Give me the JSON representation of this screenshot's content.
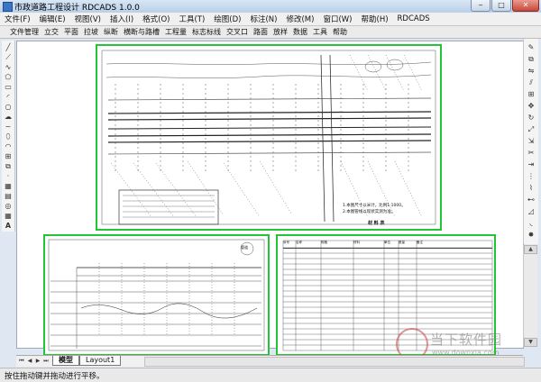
{
  "window": {
    "title": "市政道路工程设计 RDCADS 1.0.0",
    "minimize": "‒",
    "maximize": "□",
    "close": "✕"
  },
  "menubar": [
    "文件(F)",
    "编辑(E)",
    "视图(V)",
    "插入(I)",
    "格式(O)",
    "工具(T)",
    "绘图(D)",
    "标注(N)",
    "修改(M)",
    "窗口(W)",
    "帮助(H)",
    "RDCADS"
  ],
  "toolbar": [
    "文件管理",
    "立交",
    "平面",
    "拉坡",
    "纵断",
    "横断与路槽",
    "工程量",
    "标志标线",
    "交叉口",
    "路面",
    "放样",
    "数据",
    "工具",
    "帮助"
  ],
  "left_tools": [
    "line",
    "ray",
    "polyline",
    "polygon",
    "rectangle",
    "arc",
    "circle",
    "revcloud",
    "spline",
    "ellipse",
    "ellipse-arc",
    "insert-block",
    "make-block",
    "point",
    "hatch",
    "gradient",
    "region",
    "table",
    "mtext"
  ],
  "right_tools": [
    "erase",
    "copy",
    "mirror",
    "offset",
    "array",
    "move",
    "rotate",
    "scale",
    "stretch",
    "trim",
    "extend",
    "break-point",
    "break",
    "join",
    "chamfer",
    "fillet",
    "explode"
  ],
  "drawing": {
    "plan_sheet": {
      "notes_line1": "1.本图尺寸以米计，比例1:1000。",
      "notes_line2": "2.本图管线以现状实测为准。",
      "table_title": "材 料 表"
    },
    "section_sheet": {
      "stamp": "管道"
    },
    "table_sheet": {
      "header": [
        "序号",
        "名称",
        "规格",
        "材料",
        "单位",
        "数量",
        "备注"
      ]
    }
  },
  "tabs": {
    "model": "模型",
    "layout": "Layout1"
  },
  "status": "按住拖动键并拖动进行平移。",
  "watermark": {
    "text": "当下软件园",
    "url": "www.downxia.com"
  },
  "colors": {
    "sheet_border": "#22c533",
    "titlebar": "#c5d8ee"
  }
}
